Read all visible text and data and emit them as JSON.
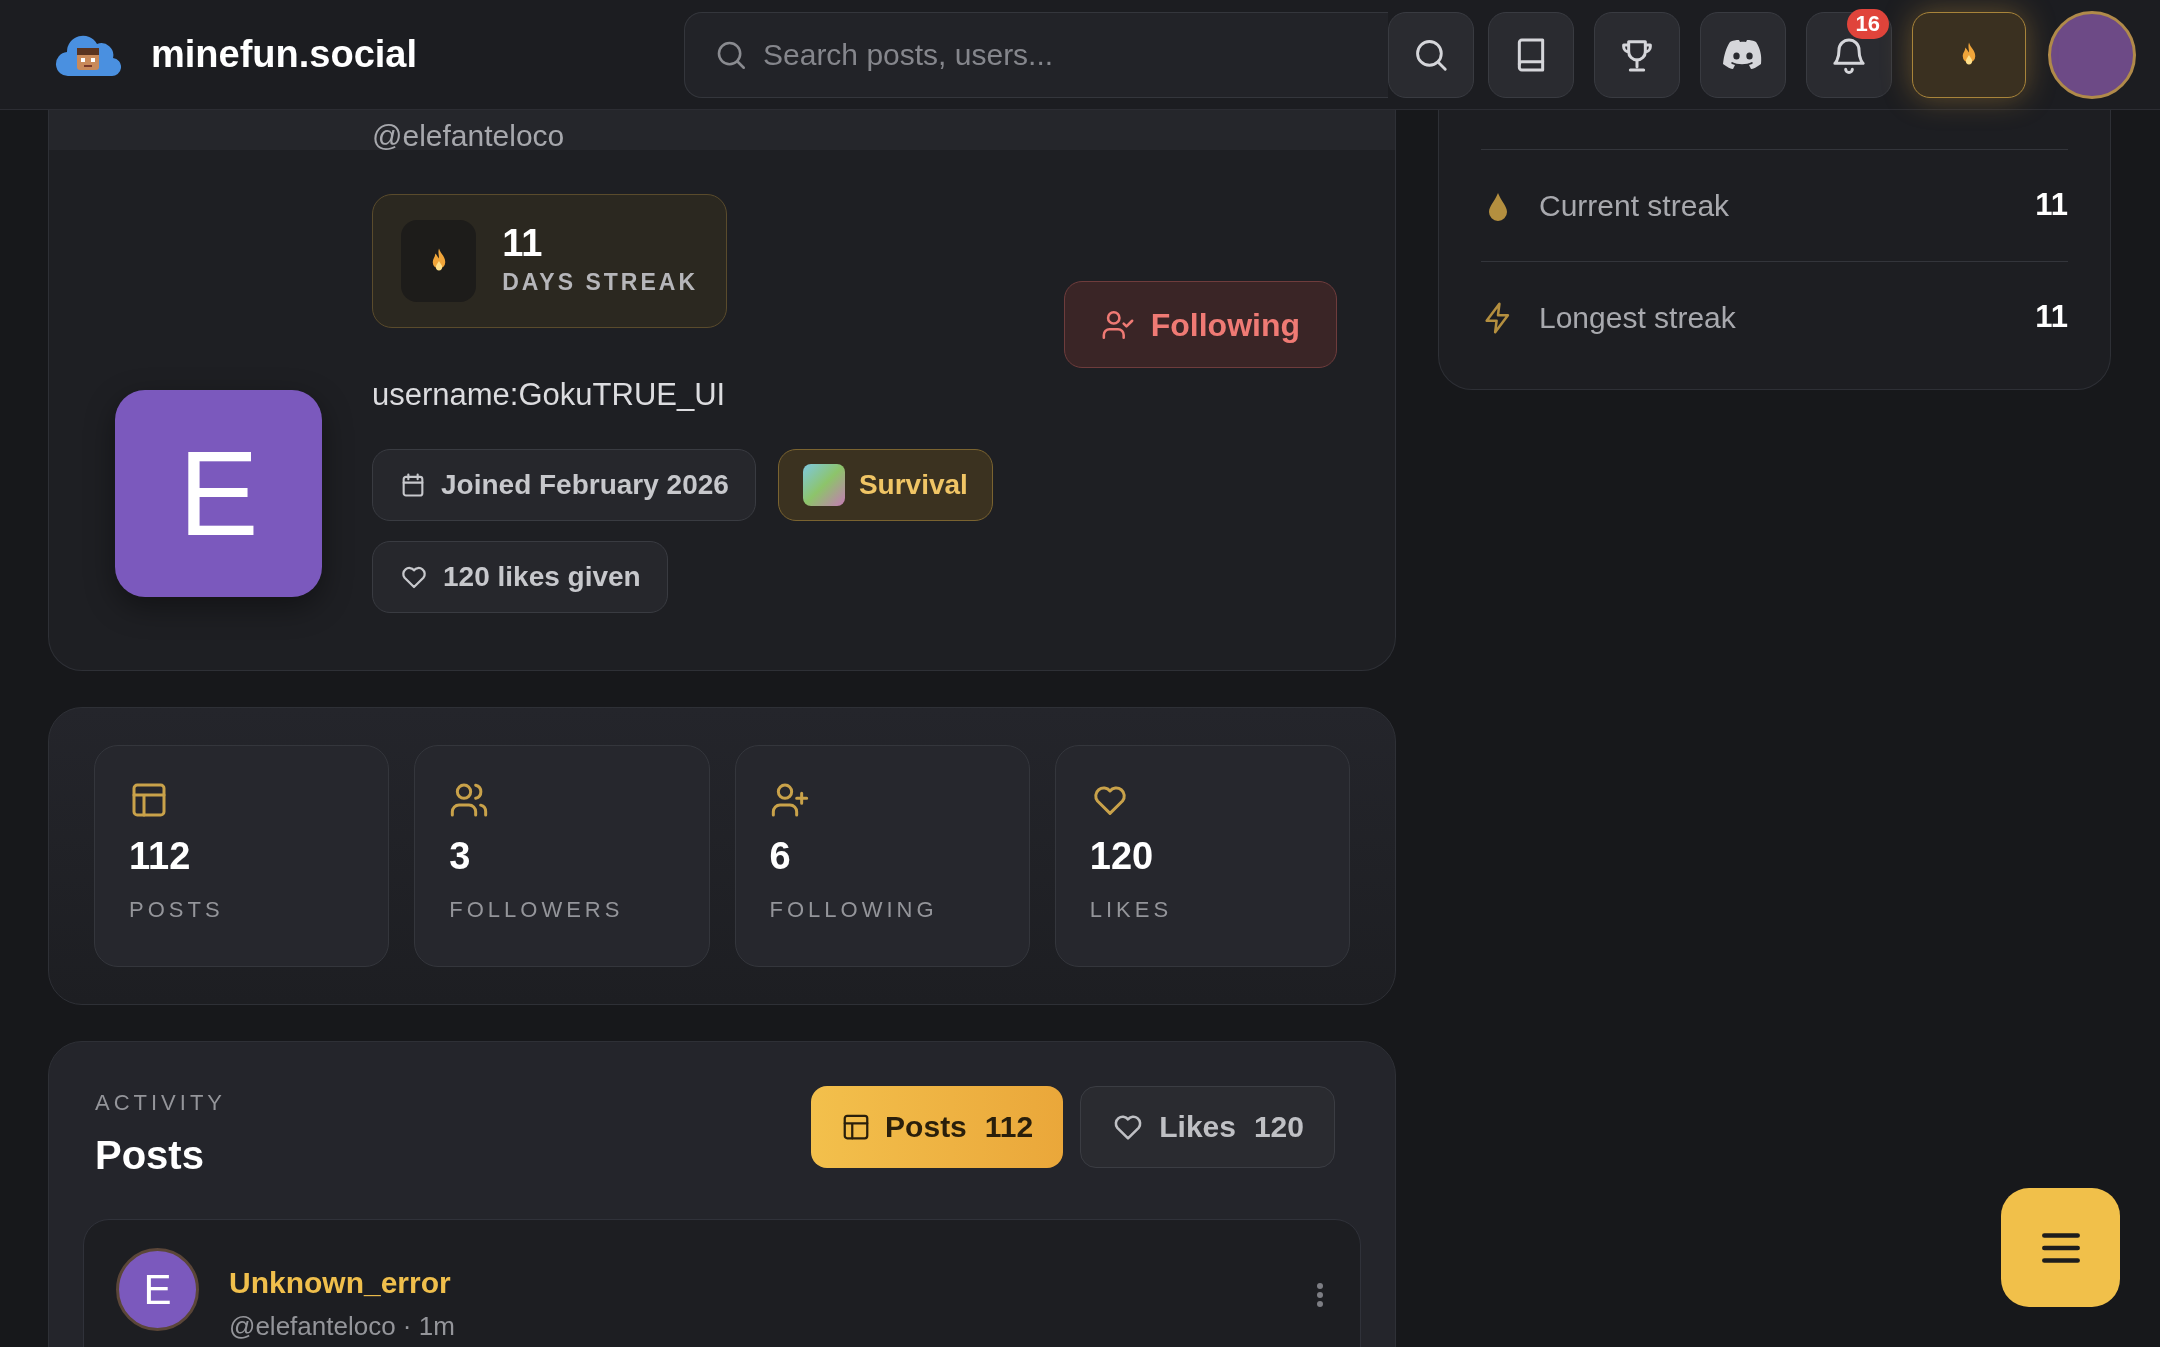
{
  "header": {
    "logo_text": "minefun.social",
    "search": {
      "placeholder": "Search posts, users..."
    },
    "notification_count": "16"
  },
  "profile": {
    "handle": "@elefanteloco",
    "streak": {
      "count": "11",
      "label": "DAYS STREAK"
    },
    "follow_button": {
      "label": "Following",
      "following": true
    },
    "bio": "username:GokuTRUE_UI",
    "avatar_letter": "E",
    "chips": [
      {
        "kind": "date",
        "label": "Joined February 2026"
      },
      {
        "kind": "mode",
        "label": "Survival"
      },
      {
        "kind": "likes",
        "label": "120 likes given"
      }
    ]
  },
  "stats": [
    {
      "kind": "posts",
      "value": "112",
      "label": "POSTS"
    },
    {
      "kind": "followers",
      "value": "3",
      "label": "FOLLOWERS"
    },
    {
      "kind": "following",
      "value": "6",
      "label": "FOLLOWING"
    },
    {
      "kind": "likes",
      "value": "120",
      "label": "LIKES"
    }
  ],
  "side_stats": [
    {
      "kind": "current",
      "label": "Current streak",
      "value": "11"
    },
    {
      "kind": "longest",
      "label": "Longest streak",
      "value": "11"
    }
  ],
  "activity": {
    "eyebrow": "ACTIVITY",
    "title": "Posts",
    "tabs": [
      {
        "kind": "posts",
        "label": "Posts",
        "count": "112",
        "selected": true
      },
      {
        "kind": "likes",
        "label": "Likes",
        "count": "120",
        "selected": false
      }
    ],
    "posts": [
      {
        "avatar_letter": "E",
        "author": "Unknown_error",
        "meta": "@elefanteloco · 1m"
      }
    ]
  }
}
